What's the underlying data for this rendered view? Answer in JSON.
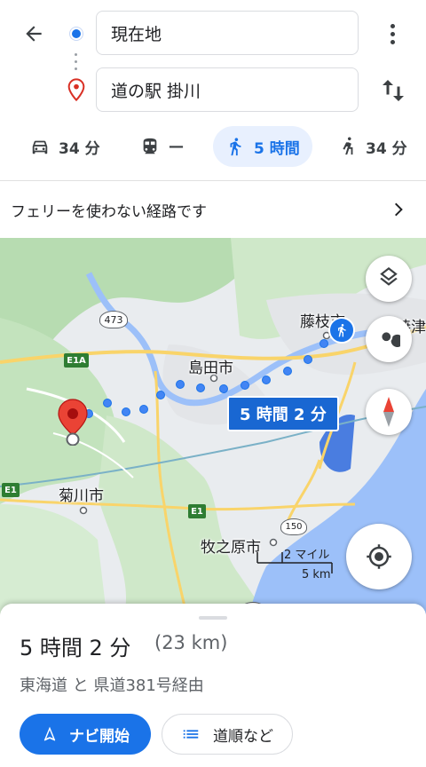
{
  "directions": {
    "origin": "現在地",
    "destination": "道の駅 掛川"
  },
  "modes": [
    {
      "name": "car",
      "icon": "car-icon",
      "label": "34 分"
    },
    {
      "name": "transit",
      "icon": "train-icon",
      "label": "—"
    },
    {
      "name": "walk",
      "icon": "walk-icon",
      "label": "5 時間",
      "active": true
    },
    {
      "name": "bike",
      "icon": "ride-icon",
      "label": "34 分"
    }
  ],
  "notice": {
    "text": "フェリーを使わない経路です"
  },
  "map": {
    "labels": {
      "shimada": "島田市",
      "kikugawa": "菊川市",
      "makinohara": "牧之原市",
      "fujieda": "藤枝市",
      "yaizu": "焼津"
    },
    "shields": {
      "route473": "473",
      "e1a": "E1A",
      "e1_left": "E1",
      "e1_mid": "E1",
      "route150": "150",
      "route150b": "150"
    },
    "route_badge": "5 時間 2 分",
    "scale": {
      "miles": "2 マイル",
      "km": "5 km"
    },
    "colors": {
      "route": "#4285f4",
      "water": "#9cc0f9",
      "accent": "#1a73e8",
      "pin": "#ea4335"
    }
  },
  "sheet": {
    "duration": "5 時間 2 分",
    "distance": "(23 km)",
    "via": "東海道 と 県道381号経由",
    "start_button": "ナビ開始",
    "steps_button": "道順など"
  }
}
